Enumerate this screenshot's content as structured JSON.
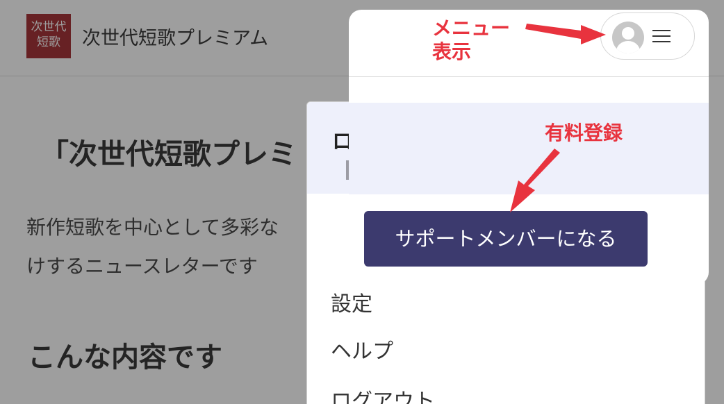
{
  "header": {
    "logo_text_line1": "次世代",
    "logo_text_line2": "短歌",
    "site_title": "次世代短歌プレミアム"
  },
  "main": {
    "title": "「次世代短歌プレミ",
    "lead": "新作短歌を中心として多彩な\nけするニュースレターです",
    "section_title": "こんな内容です"
  },
  "menu": {
    "login_label": "ログイン中",
    "support_button": "サポートメンバーになる",
    "items": [
      {
        "label": "設定"
      },
      {
        "label": "ヘルプ"
      },
      {
        "label": "ログアウト"
      }
    ]
  },
  "annotations": {
    "menu_line1": "メニュー",
    "menu_line2": "表示",
    "paid": "有料登録"
  },
  "colors": {
    "logo_red": "#9b1c22",
    "button_navy": "#3c3a6e",
    "annotation_red": "#e8333e",
    "login_area_bg": "#eef0fb"
  },
  "icons": {
    "avatar": "user-avatar-icon",
    "menu": "hamburger-menu-icon"
  }
}
